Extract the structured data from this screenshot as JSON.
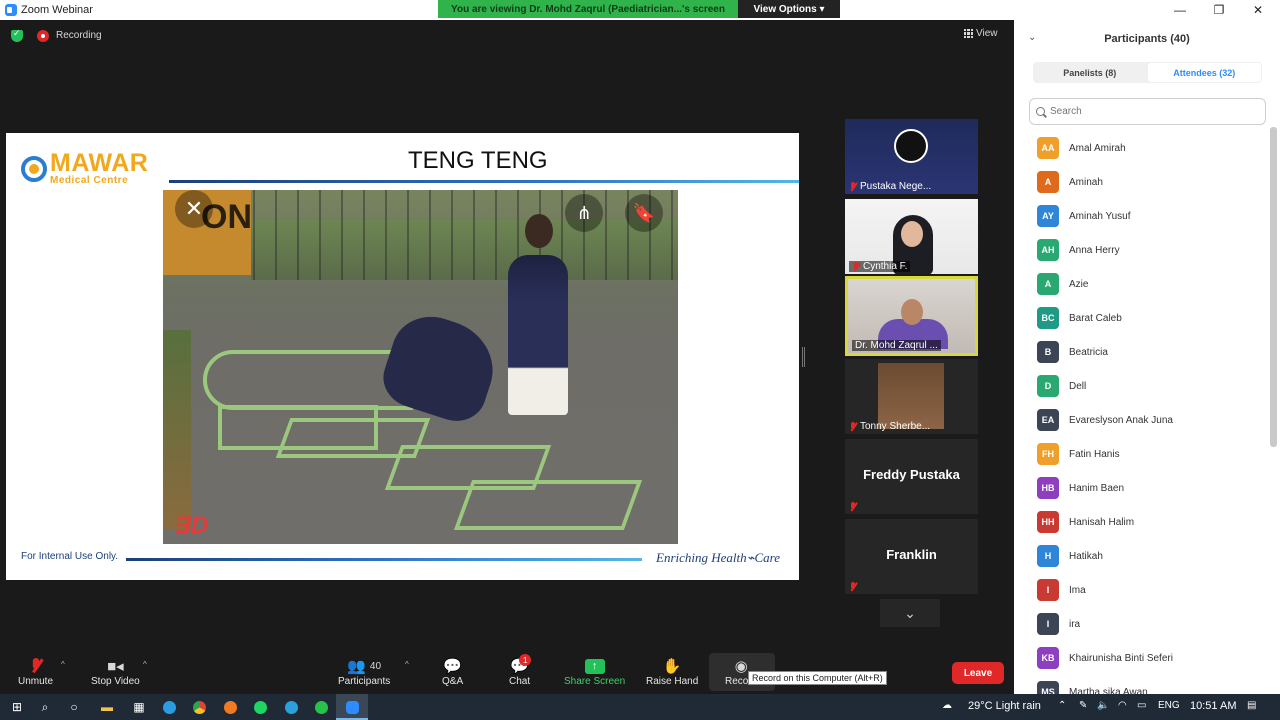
{
  "window": {
    "title": "Zoom Webinar",
    "minimize": "—",
    "restore": "❐",
    "close": "✕"
  },
  "banner": {
    "viewing": "You are viewing Dr. Mohd Zaqrul (Paediatrician...'s screen",
    "view_options": "View Options ▾"
  },
  "meeting": {
    "recording_label": "Recording",
    "view_label": "View"
  },
  "slide": {
    "logo_main": "MAWAR",
    "logo_sub": "Medical Centre",
    "title": "TENG TENG",
    "photo_sign": "ON",
    "photo_watermark": "ƎD",
    "footnote": "For Internal Use Only.",
    "tagline": "Enriching Health⌁Care"
  },
  "tiles": [
    {
      "name": "Pustaka Nege...",
      "type": "logo"
    },
    {
      "name": "Cynthia F.",
      "type": "video"
    },
    {
      "name": "Dr. Mohd Zaqrul ...",
      "type": "video",
      "active": true
    },
    {
      "name": "Tonny Sherbe...",
      "type": "video"
    },
    {
      "name": "Freddy Pustaka",
      "type": "name-only"
    },
    {
      "name": "Franklin",
      "type": "name-only"
    }
  ],
  "toolbar": {
    "unmute": "Unmute",
    "stop_video": "Stop Video",
    "participants": "Participants",
    "participants_count": "40",
    "qa": "Q&A",
    "chat": "Chat",
    "chat_badge": "1",
    "share_screen": "Share Screen",
    "raise_hand": "Raise Hand",
    "record": "Record",
    "record_tooltip": "Record on this Computer (Alt+R)",
    "leave": "Leave"
  },
  "panel": {
    "title": "Participants (40)",
    "tabs": [
      "Panelists (8)",
      "Attendees (32)"
    ],
    "selected_tab": 1,
    "search_placeholder": "Search",
    "attendees": [
      {
        "initials": "AA",
        "name": "Amal Amirah",
        "color": "#f0a02a"
      },
      {
        "initials": "A",
        "name": "Aminah",
        "color": "#e06a1b"
      },
      {
        "initials": "AY",
        "name": "Aminah Yusuf",
        "color": "#2f86d8"
      },
      {
        "initials": "AH",
        "name": "Anna Herry",
        "color": "#2aa872"
      },
      {
        "initials": "A",
        "name": "Azie",
        "color": "#2aa872"
      },
      {
        "initials": "BC",
        "name": "Barat Caleb",
        "color": "#1f9a86"
      },
      {
        "initials": "B",
        "name": "Beatricia",
        "color": "#3b4556"
      },
      {
        "initials": "D",
        "name": "Dell",
        "color": "#2aa872"
      },
      {
        "initials": "EA",
        "name": "Evareslyson Anak Juna",
        "color": "#3b4556"
      },
      {
        "initials": "FH",
        "name": "Fatin Hanis",
        "color": "#f0a02a"
      },
      {
        "initials": "HB",
        "name": "Hanim Baen",
        "color": "#8e3fbf"
      },
      {
        "initials": "HH",
        "name": "Hanisah Halim",
        "color": "#c93b32"
      },
      {
        "initials": "H",
        "name": "Hatikah",
        "color": "#2f86d8"
      },
      {
        "initials": "I",
        "name": "Ima",
        "color": "#c93b32"
      },
      {
        "initials": "I",
        "name": "ira",
        "color": "#3b4556"
      },
      {
        "initials": "KB",
        "name": "Khairunisha Binti Seferi",
        "color": "#8e3fbf"
      },
      {
        "initials": "MS",
        "name": "Martha sika Awan",
        "color": "#3b4556"
      }
    ]
  },
  "taskbar": {
    "weather": "29°C  Light rain",
    "language": "ENG",
    "time": "10:51 AM"
  }
}
